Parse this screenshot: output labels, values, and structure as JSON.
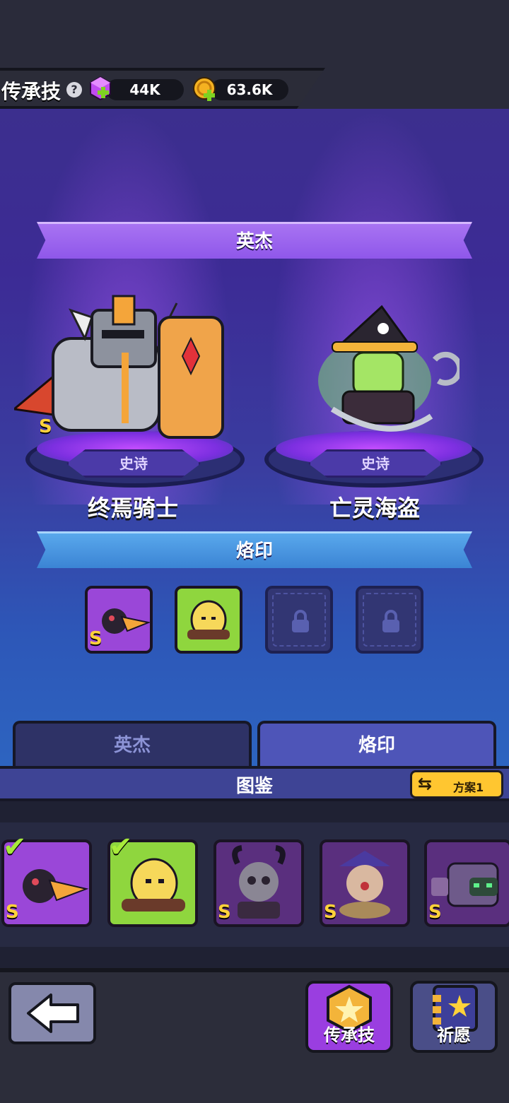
{
  "header": {
    "title": "传承技",
    "help_label": "?",
    "gems": "44K",
    "coins": "63.6K"
  },
  "stage": {
    "heroes_banner": "英杰",
    "imprint_banner": "烙印",
    "heroes": [
      {
        "name": "终焉骑士",
        "rarity": "史诗",
        "rank": "S"
      },
      {
        "name": "亡灵海盗",
        "rarity": "史诗"
      }
    ],
    "imprint_slots": [
      {
        "state": "filled",
        "rank": "S"
      },
      {
        "state": "filled"
      },
      {
        "state": "locked"
      },
      {
        "state": "locked"
      }
    ]
  },
  "tabs": [
    {
      "label": "英杰",
      "active": false
    },
    {
      "label": "烙印",
      "active": true
    }
  ],
  "codex": {
    "title": "图鉴",
    "plan_label": "方案1",
    "cards": [
      {
        "rank": "S",
        "owned": true
      },
      {
        "owned": true
      },
      {
        "rank": "S",
        "owned": false
      },
      {
        "rank": "S",
        "owned": false
      },
      {
        "rank": "S",
        "owned": false
      }
    ]
  },
  "bottom": {
    "legacy_label": "传承技",
    "wish_label": "祈愿"
  },
  "colors": {
    "heroes_banner": "#9b62ee",
    "imprint_banner": "#4a96e0",
    "plan_button": "#ffc630",
    "legacy_button": "#9a3ee0"
  }
}
